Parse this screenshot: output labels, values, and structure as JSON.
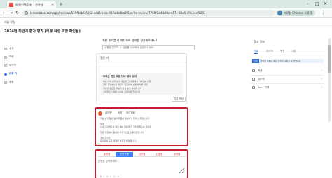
{
  "browser": {
    "tab_title": "채용연구(공개) - 퀸겐빌",
    "new_tab": "+",
    "url": "lemonbase.com/app/reviews/519f4ab6-6152-4cd5-afee-987adb8ba3f5/write-review/7759f2ad-b89c-457c-85d5-49e34ef6243",
    "profile_text": "에로잘 Chrome 사용 중",
    "minimize": "–",
    "maximize": "□",
    "close": "✕",
    "back": "←",
    "forward": "→",
    "reload": "↻",
    "menu": "⋮",
    "colors": {
      "tab_bg": "#dbe8e4",
      "accent": "#2d6ed8",
      "highlight": "#c0202a"
    }
  },
  "app": {
    "header_label": "리뷰 작성",
    "page_title": "2024년 하반기 평가 평가 (리뷰 작성 과정 확인용)"
  },
  "sidebar": {
    "items": [
      {
        "label": "성과",
        "active": false
      },
      {
        "label": "역량",
        "active": false
      },
      {
        "label": "피드백",
        "active": false
      },
      {
        "label": "리뷰 기",
        "active": true
      },
      {
        "label": "종합",
        "active": false
      }
    ]
  },
  "main": {
    "question": "지난 분기를 한 마디하여 성과를 평가해주세요?",
    "question_sub": "수행한 업무와 그 성과를 자세하게 설명해주세요.",
    "guide": {
      "title": "질문 가",
      "box_title": "우리는 개인 목표 대비 대비 성과",
      "lines": [
        "목표 대비 실제 달성 정도와 그 과정에서 기여도를 설명",
        "협업 과정에서의 역할과 동료와의 소통 방식을 작성",
        "개선이 필요한 부분과 다음 분기 계획을 정리",
        "구체적인 사례와 수치를 포함하면 좋습니다"
      ],
      "footer_button": "기본 작성"
    },
    "answer": {
      "author": "김태준",
      "role": "팀장",
      "date": "하이퍼링",
      "lines": [
        "지난 분기 동안 팀의 목표를 달성하기 위해 노력했습니다.",
        "",
        "성과",
        "신규 프로젝트를 일정 내에 완료하고 고객 만족도를 개선함.",
        "",
        "협업 과정에서 동료와 적극적으로 소통하였습니다.",
        "",
        "개선 포인트",
        "문서화와 공유 과정을 보완할 예정입니다."
      ]
    },
    "editor": {
      "tabs": [
        {
          "label": "유지형",
          "active": false
        },
        {
          "label": "전문가형",
          "active": true
        },
        {
          "label": "친근형",
          "active": false
        },
        {
          "label": "간결형",
          "active": false
        },
        {
          "label": "상세형",
          "active": false
        }
      ],
      "placeholder": "답변을 입력하세요...",
      "tools": "B I U S ≡ ⊕"
    }
  },
  "right_panel": {
    "title": "참고 정보",
    "tabs": [
      {
        "label": "리뷰",
        "active": true
      },
      {
        "label": "피드백",
        "active": false
      },
      {
        "label": "목표",
        "active": false
      },
      {
        "label": "기록",
        "active": false
      }
    ],
    "notice_badge": "안내",
    "notice_text": "작성한 리뷰는 제출 전까지 수정할 수 있습니다",
    "rows": [
      {
        "label": "목표"
      },
      {
        "label": "피드백"
      },
      {
        "label": "1on1 기록"
      }
    ],
    "chevron": "›"
  }
}
